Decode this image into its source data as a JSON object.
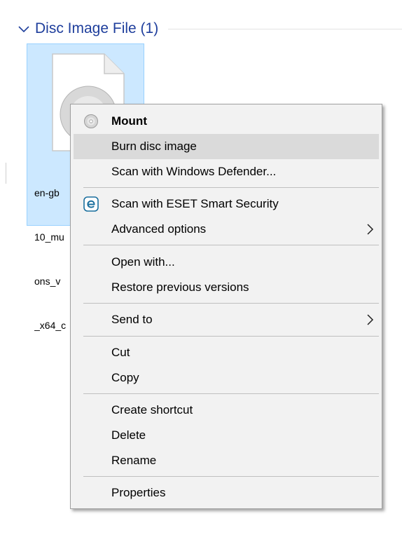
{
  "group": {
    "title": "Disc Image File (1)",
    "icon": "chevron-down-icon"
  },
  "file": {
    "name_lines": [
      "en-gb",
      "10_mu",
      "ons_v",
      "_x64_c"
    ],
    "icon": "disc-image-file-icon",
    "selected": true
  },
  "menu": {
    "items": [
      {
        "label": "Mount",
        "bold": true,
        "icon": "disc-icon"
      },
      {
        "label": "Burn disc image",
        "highlighted": true
      },
      {
        "label": "Scan with Windows Defender..."
      },
      {
        "label": "Scan with ESET Smart Security",
        "icon": "eset-icon"
      },
      {
        "label": "Advanced options",
        "submenu": true
      },
      {
        "label": "Open with..."
      },
      {
        "label": "Restore previous versions"
      },
      {
        "label": "Send to",
        "submenu": true
      },
      {
        "label": "Cut"
      },
      {
        "label": "Copy"
      },
      {
        "label": "Create shortcut"
      },
      {
        "label": "Delete"
      },
      {
        "label": "Rename"
      },
      {
        "label": "Properties"
      }
    ]
  },
  "colors": {
    "accent": "#1e3e9c",
    "selection_bg": "#cce8ff",
    "selection_border": "#99d1ff",
    "menu_bg": "#f2f2f2",
    "menu_highlight": "#dadada",
    "eset_icon": "#1a6f9e"
  }
}
